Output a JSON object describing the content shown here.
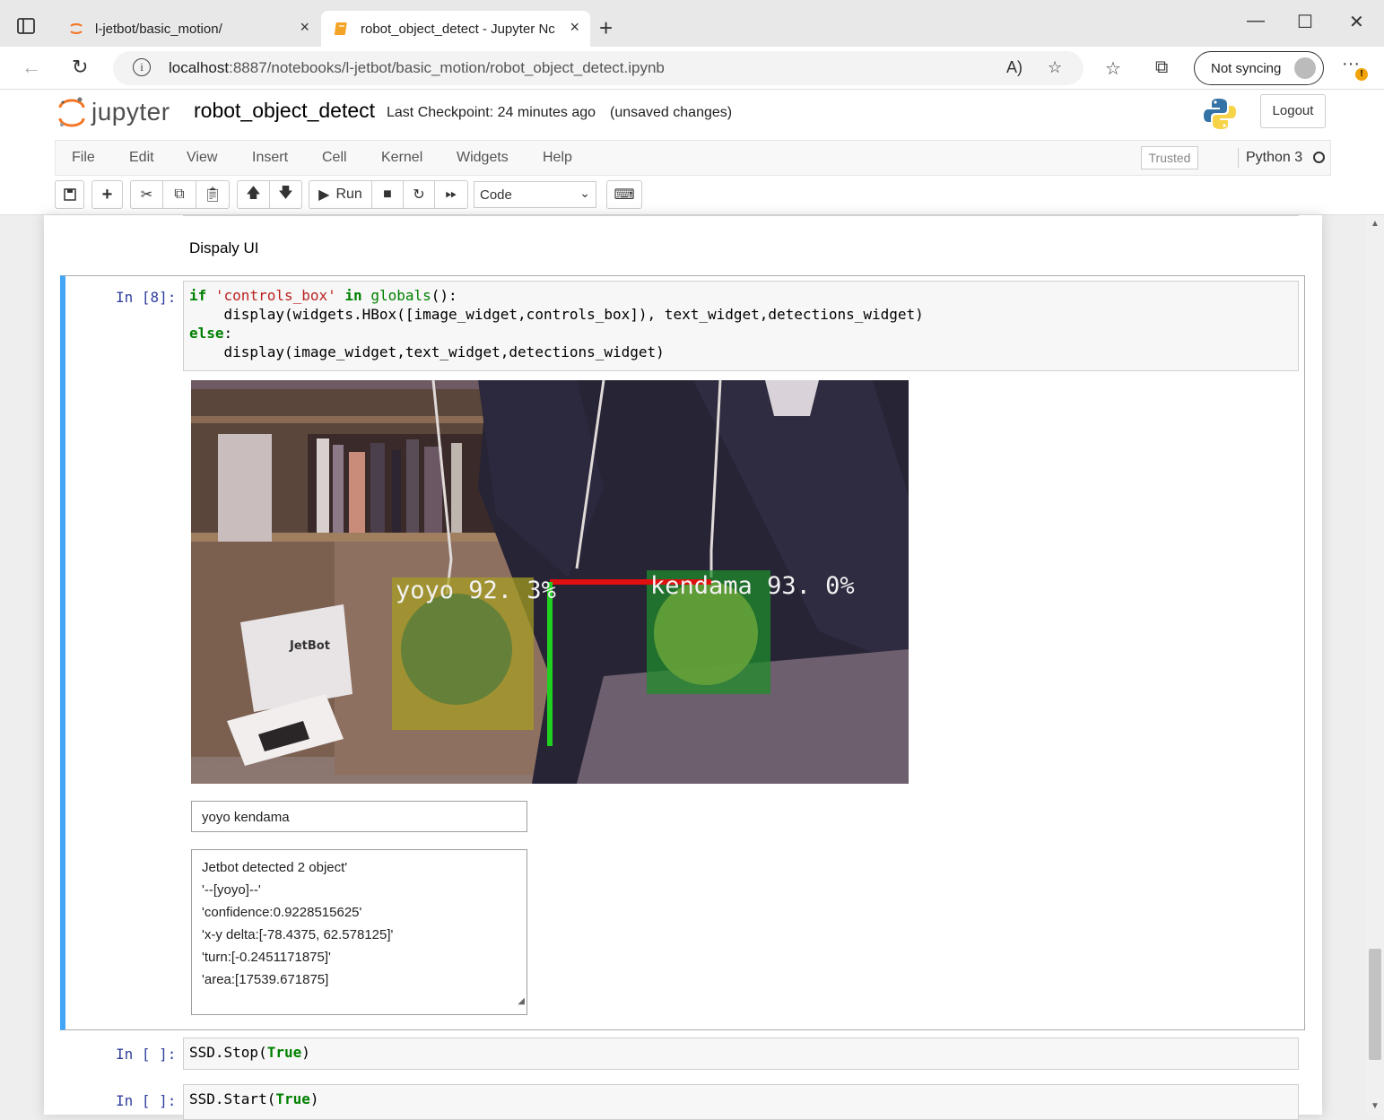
{
  "browser": {
    "tabs": [
      {
        "title": "l-jetbot/basic_motion/",
        "close": "×"
      },
      {
        "title": "robot_object_detect - Jupyter Nc",
        "close": "×"
      }
    ],
    "new_tab": "+",
    "window_controls": {
      "minimize": "—",
      "maximize": "☐",
      "close": "✕"
    },
    "url_host": "localhost",
    "url_rest": ":8887/notebooks/l-jetbot/basic_motion/robot_object_detect.ipynb",
    "sync_label": "Not syncing"
  },
  "jupyter": {
    "logo_text": "jupyter",
    "notebook_name": "robot_object_detect",
    "checkpoint": "Last Checkpoint: 24 minutes ago",
    "unsaved": "(unsaved changes)",
    "logout": "Logout",
    "menu": [
      "File",
      "Edit",
      "View",
      "Insert",
      "Cell",
      "Kernel",
      "Widgets",
      "Help"
    ],
    "trusted": "Trusted",
    "kernel": "Python 3",
    "run_label": "Run",
    "cell_type": "Code"
  },
  "notebook": {
    "markdown": "Dispaly UI",
    "cell8": {
      "prompt": "In [8]:",
      "code": [
        "if 'controls_box' in globals():",
        "    display(widgets.HBox([image_widget,controls_box]), text_widget,detections_widget)",
        "else:",
        "    display(image_widget,text_widget,detections_widget)"
      ],
      "detections": [
        {
          "label": "yoyo",
          "score": "92. 3%"
        },
        {
          "label": "kendama",
          "score": "93. 0%"
        }
      ],
      "camera_labels": {
        "box_brand": "JetBot"
      },
      "text_widget_value": "yoyo kendama",
      "detections_text": [
        "Jetbot detected 2 object'",
        "'--[yoyo]--'",
        "'confidence:0.9228515625'",
        "'x-y delta:[-78.4375, 62.578125]'",
        "'turn:[-0.2451171875]'",
        "'area:[17539.671875]"
      ]
    },
    "cell_stop": {
      "prompt": "In [ ]:",
      "code_obj": "SSD.Stop(",
      "code_kw": "True",
      "code_end": ")"
    },
    "cell_start": {
      "prompt": "In [ ]:",
      "code_obj": "SSD.Start(",
      "code_kw": "True",
      "code_end": ")"
    }
  },
  "colors": {
    "selected_cell_border": "#42a5f5",
    "prompt": "#303f9f",
    "keyword": "#008000",
    "string": "#ba2121",
    "detect_yoyo": "#a8a020",
    "detect_kendama": "#1e8f2a"
  }
}
